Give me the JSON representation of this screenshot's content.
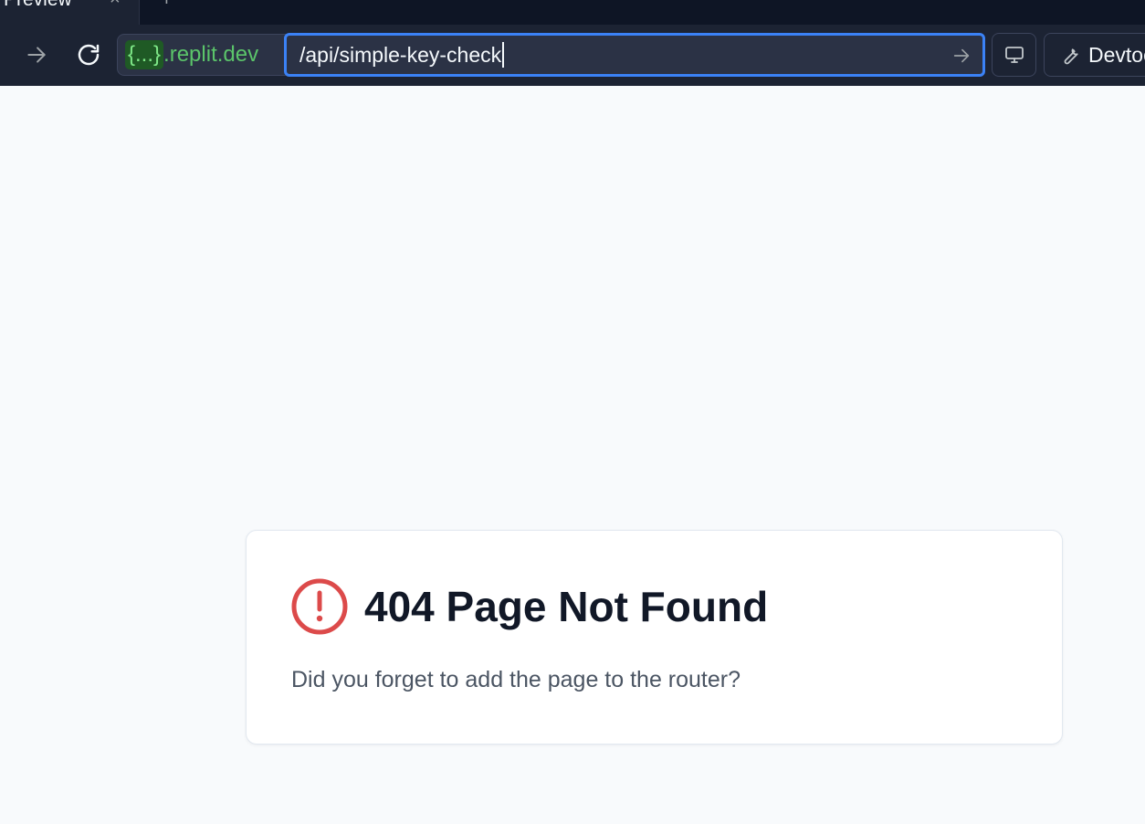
{
  "tab": {
    "title": "Preview",
    "close_symbol": "×",
    "new_tab_symbol": "+"
  },
  "icons": {
    "forward": "arrow-right-icon",
    "reload": "reload-icon",
    "go": "arrow-right-icon",
    "devices": "monitor-icon",
    "devtools": "wrench-icon",
    "error": "alert-circle-icon"
  },
  "address_bar": {
    "domain_prefix": "{...}",
    "domain_suffix": ".replit.dev",
    "path": "/api/simple-key-check"
  },
  "toolbar": {
    "devtools_label": "Devtools"
  },
  "error": {
    "title": "404 Page Not Found",
    "message": "Did you forget to add the page to the router?"
  },
  "colors": {
    "chrome_background": "#1c2333",
    "focus_ring": "#3b82f6",
    "domain_text": "#5bc46a",
    "page_background": "#f8fafc",
    "error_icon": "#dc2626"
  }
}
